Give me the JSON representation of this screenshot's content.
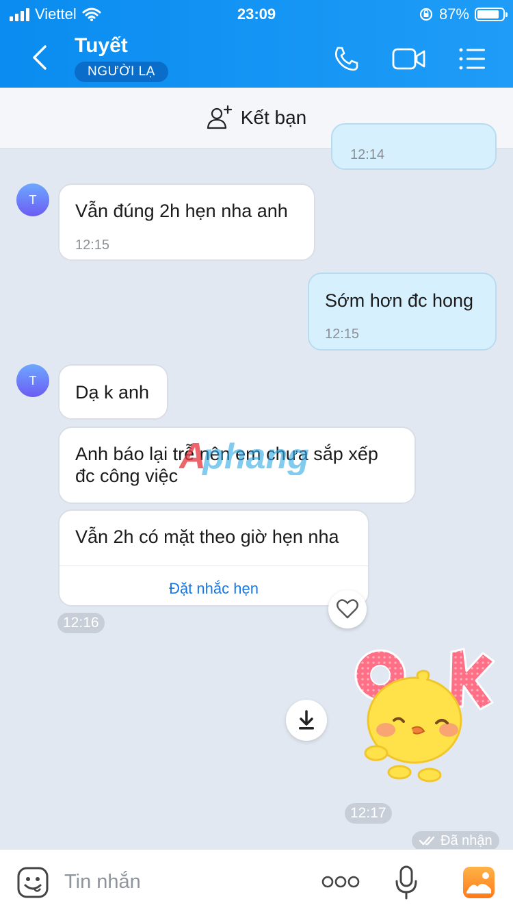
{
  "status_bar": {
    "carrier": "Viettel",
    "time": "23:09",
    "battery": "87%",
    "battery_level": 0.87
  },
  "header": {
    "contact_name": "Tuyết",
    "badge": "NGƯỜI LẠ"
  },
  "add_friend": {
    "label": "Kết bạn"
  },
  "messages": {
    "prev_time": "12:14",
    "m1": {
      "avatar": "T",
      "text": "Vẫn đúng 2h hẹn nha anh",
      "time": "12:15"
    },
    "m2": {
      "text": "Sớm hơn đc hong",
      "time": "12:15"
    },
    "m3": {
      "avatar": "T",
      "text": "Dạ k anh"
    },
    "m4": {
      "text": "Anh báo lại trễ nên em chưa sắp xếp đc công việc"
    },
    "m5": {
      "text": "Vẫn 2h có mặt theo giờ hẹn nha",
      "reminder": "Đặt nhắc hẹn",
      "time": "12:16"
    },
    "sticker": {
      "time": "12:17"
    },
    "received": "Đã nhận"
  },
  "watermark": "Aphang",
  "input": {
    "placeholder": "Tin nhắn"
  },
  "colors": {
    "header": "#0a8cf0",
    "my_bubble": "#d7f0fd",
    "link": "#1677e6"
  }
}
